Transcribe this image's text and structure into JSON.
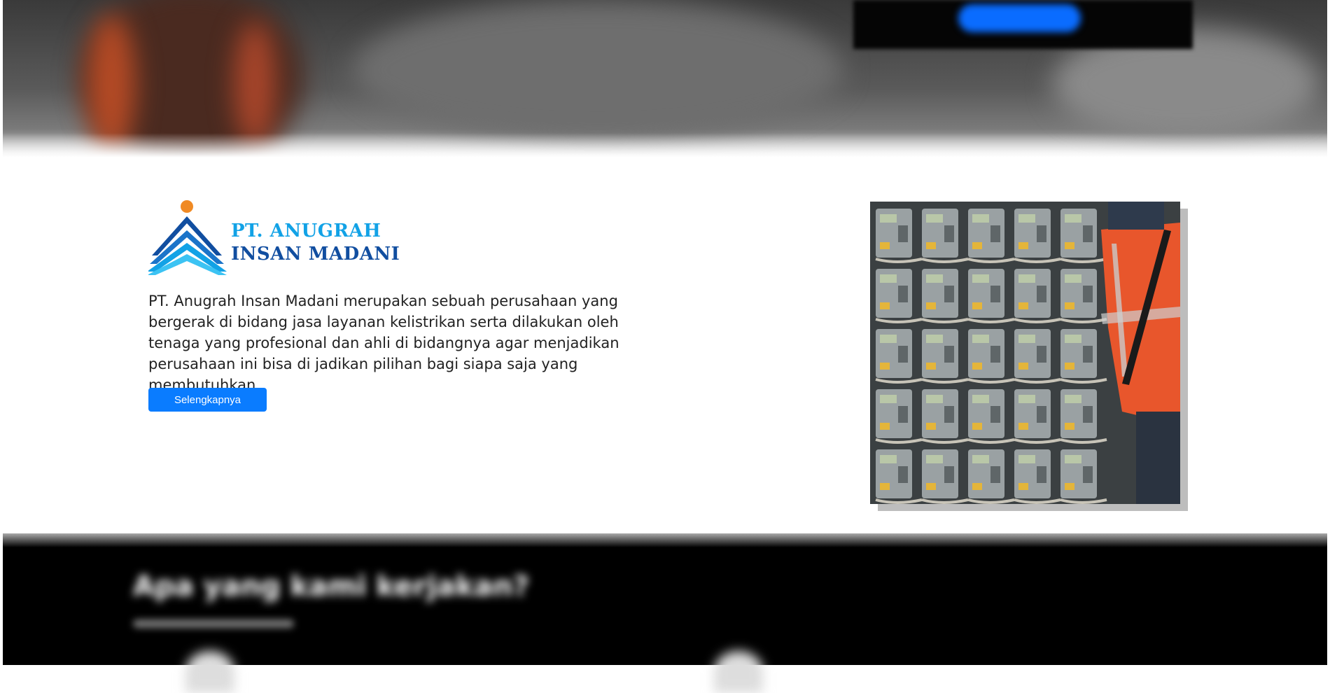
{
  "hero": {
    "cta_label": ""
  },
  "about": {
    "logo": {
      "line1": "PT. ANUGRAH",
      "line2": "INSAN MADANI"
    },
    "description": "PT. Anugrah Insan Madani merupakan sebuah perusahaan yang bergerak di bidang jasa layanan kelistrikan serta dilakukan oleh tenaga yang profesional dan ahli di bidangnya agar menjadikan perusahaan ini bisa di jadikan pilihan bagi siapa saja yang membutuhkan.",
    "button_label": "Selengkapnya"
  },
  "next_section": {
    "title": "Apa yang kami kerjakan?"
  },
  "colors": {
    "accent_blue": "#0a7cff",
    "logo_light_blue": "#12a2e6",
    "logo_dark_blue": "#114ea0",
    "logo_orange": "#f08a24"
  }
}
